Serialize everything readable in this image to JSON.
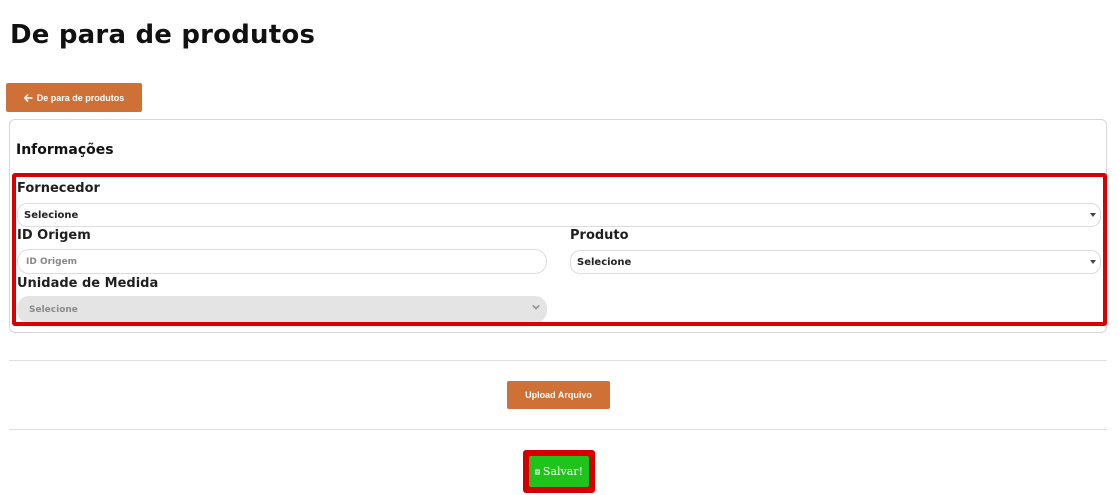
{
  "page": {
    "title": "De para de produtos"
  },
  "back_button": {
    "label": "De para de produtos",
    "icon": "arrow-left-icon"
  },
  "card": {
    "title": "Informações",
    "fornecedor": {
      "label": "Fornecedor",
      "value": "Selecione"
    },
    "id_origem": {
      "label": "ID Origem",
      "placeholder": "ID Origem",
      "value": ""
    },
    "produto": {
      "label": "Produto",
      "value": "Selecione"
    },
    "unidade_medida": {
      "label": "Unidade de Medida",
      "value": "Selecione",
      "disabled": true
    }
  },
  "upload_button": {
    "label": "Upload Arquivo"
  },
  "save_button": {
    "label": "Salvar!",
    "icon": "floppy-disk-icon"
  },
  "colors": {
    "accent_orange": "#cf7036",
    "save_green": "#1fc31a",
    "highlight_red": "#d80000"
  }
}
